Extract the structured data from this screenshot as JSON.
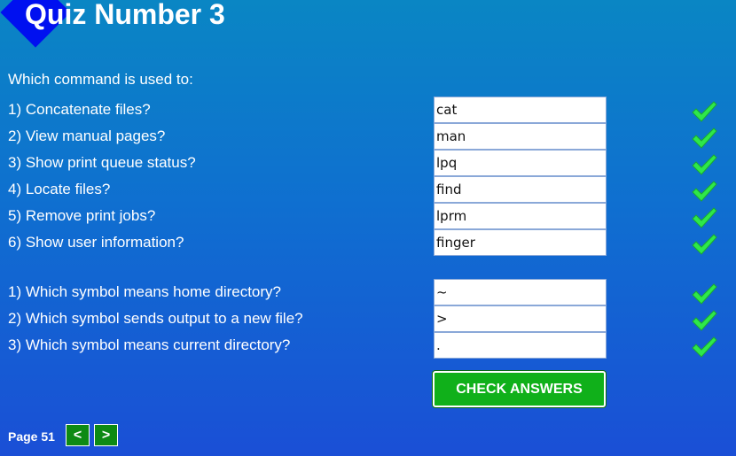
{
  "header": {
    "title": "Quiz Number 3"
  },
  "section1": {
    "intro": "Which command is used to:",
    "questions": [
      {
        "label": "1) Concatenate files?",
        "answer": "cat"
      },
      {
        "label": "2) View manual pages?",
        "answer": "man"
      },
      {
        "label": "3) Show print queue status?",
        "answer": "lpq"
      },
      {
        "label": "4) Locate files?",
        "answer": "find"
      },
      {
        "label": "5) Remove print jobs?",
        "answer": "lprm"
      },
      {
        "label": "6) Show user information?",
        "answer": "finger"
      }
    ]
  },
  "section2": {
    "questions": [
      {
        "label": "1) Which symbol means home directory?",
        "answer": "~"
      },
      {
        "label": "2) Which symbol sends output to a new file?",
        "answer": ">"
      },
      {
        "label": "3) Which symbol means current directory?",
        "answer": "."
      }
    ]
  },
  "check_answers_label": "CHECK ANSWERS",
  "result_icon": "green-checkmark",
  "colors": {
    "check_green": "#2ee84a",
    "button_green": "#10b01a",
    "diamond_blue": "#0010f0"
  },
  "footer": {
    "page_label": "Page 51",
    "prev_label": "<",
    "next_label": ">"
  }
}
